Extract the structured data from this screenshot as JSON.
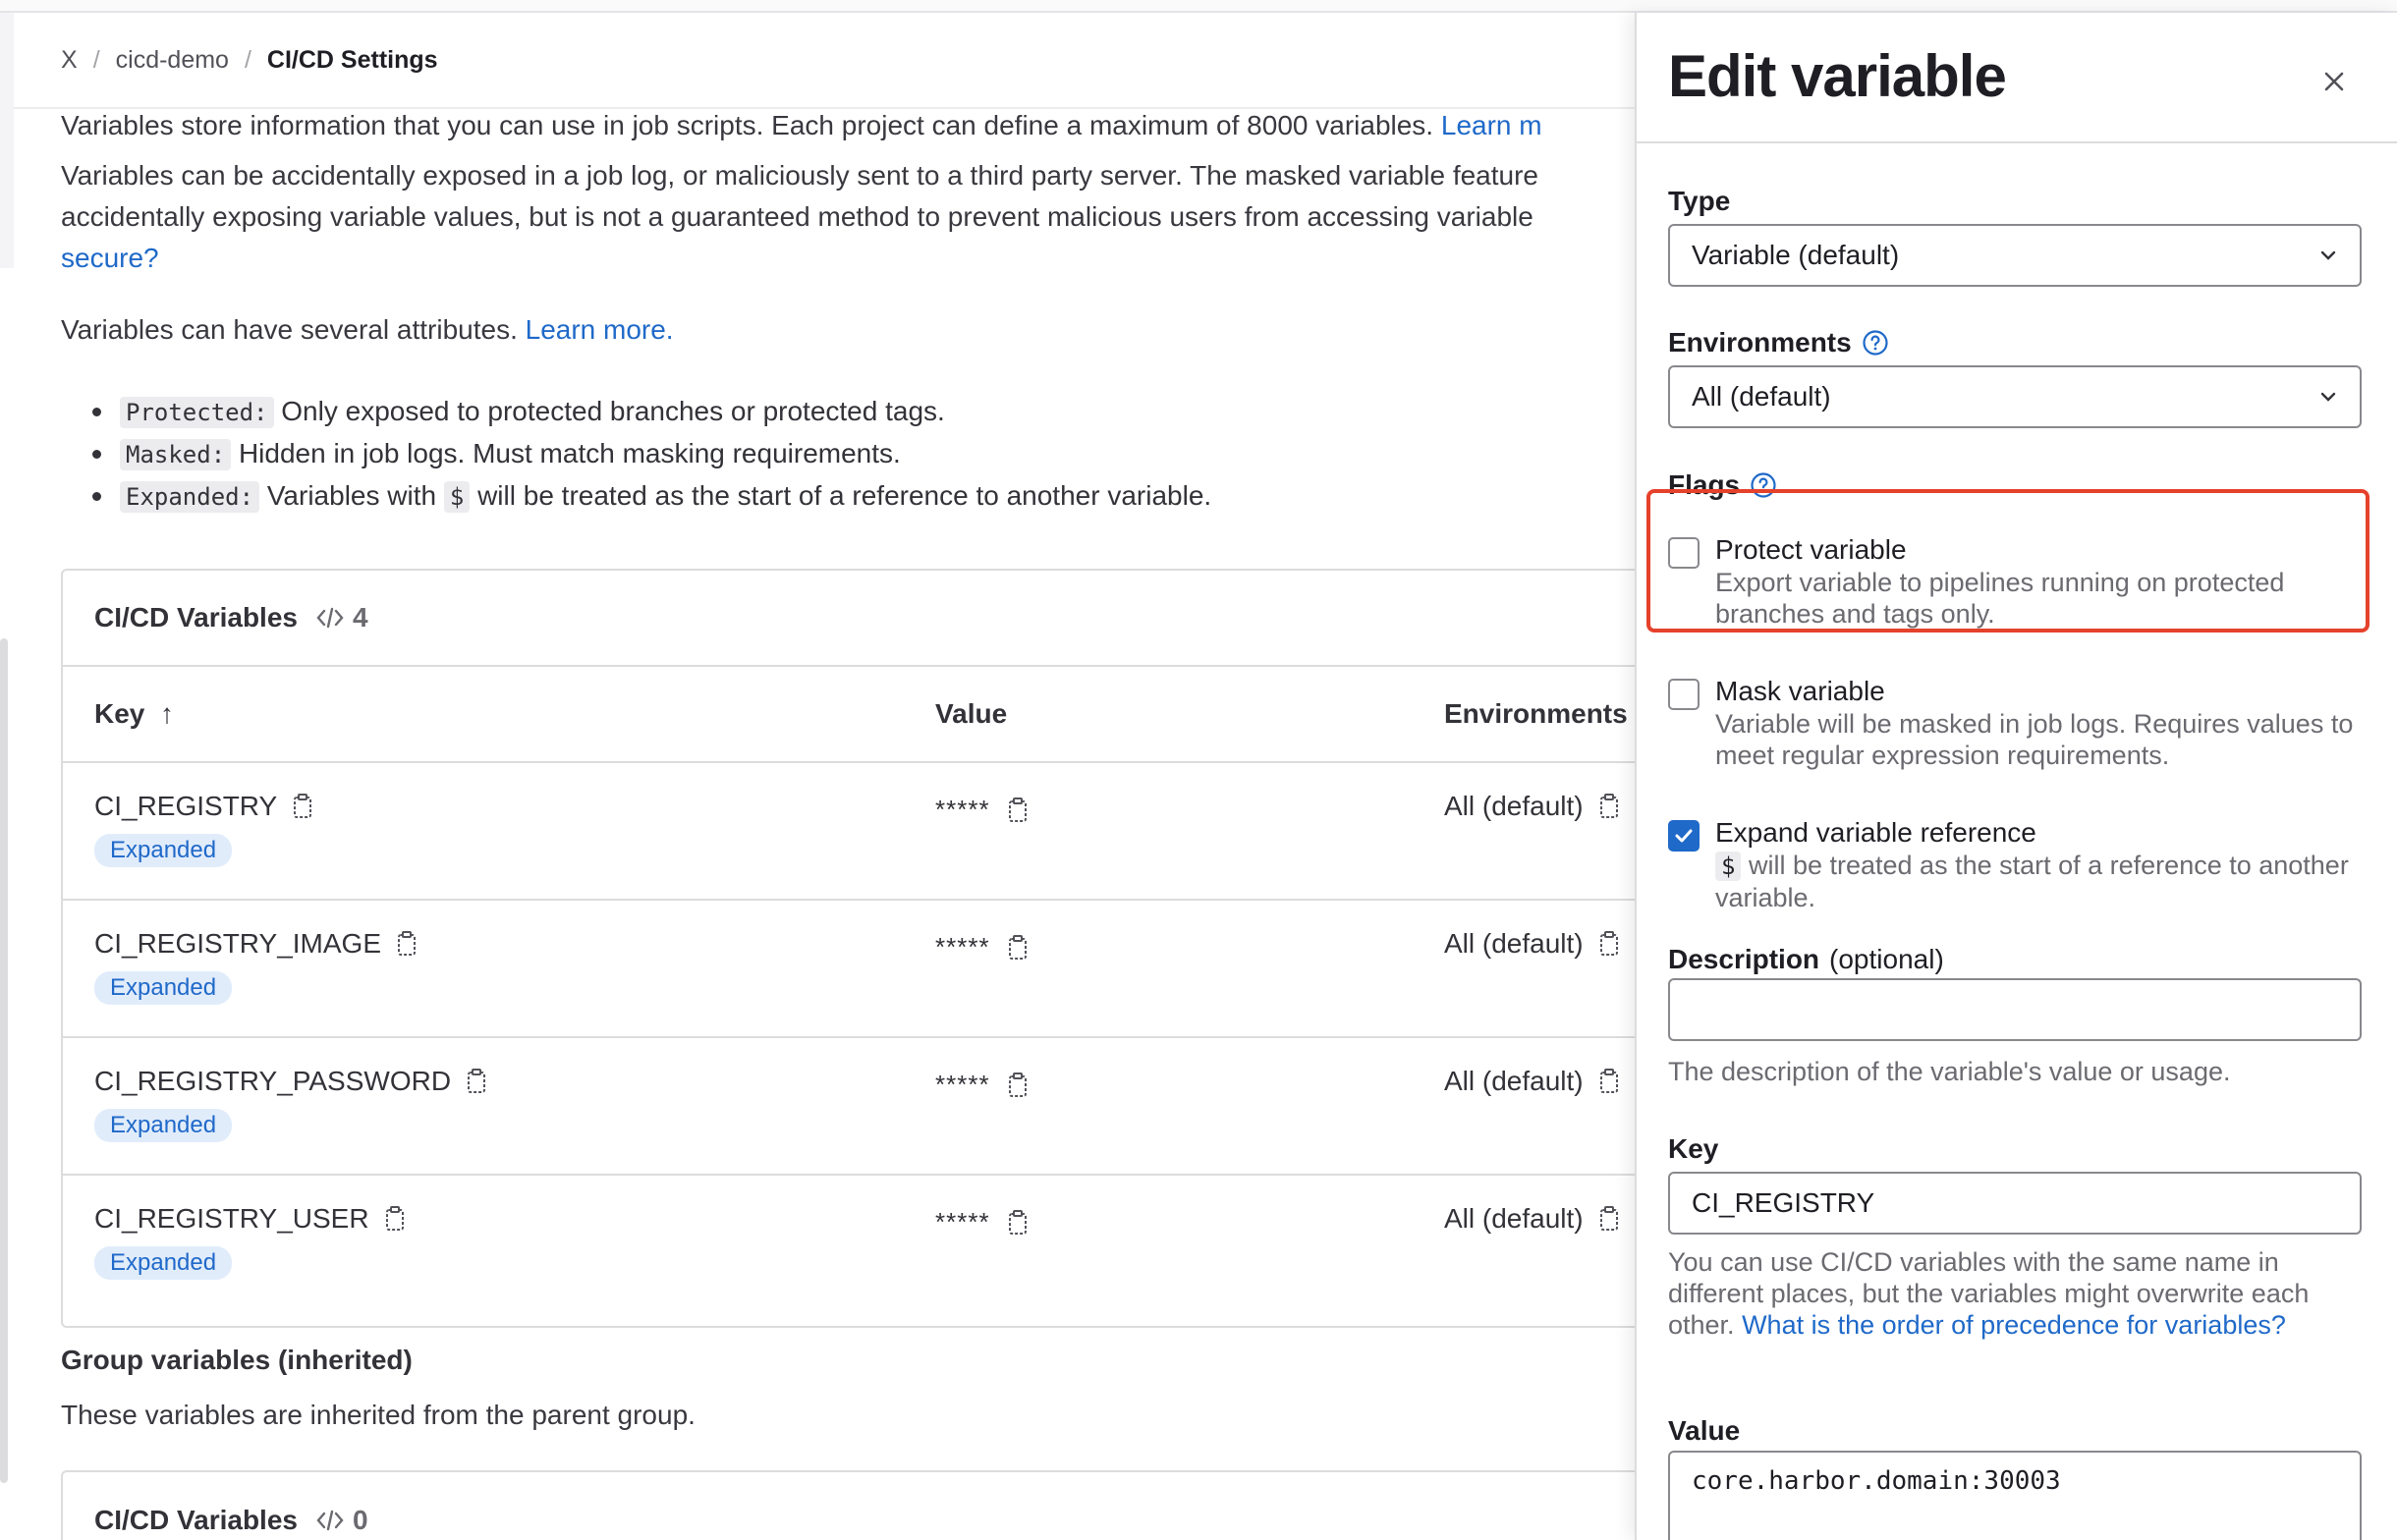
{
  "breadcrumb": {
    "root": "X",
    "project": "cicd-demo",
    "current": "CI/CD Settings"
  },
  "intro": {
    "line1": "Variables store information that you can use in job scripts. Each project can define a maximum of 8000 variables.",
    "line1_link": "Learn m",
    "para2_line1": "Variables can be accidentally exposed in a job log, or maliciously sent to a third party server. The masked variable feature",
    "para2_line2": "accidentally exposing variable values, but is not a guaranteed method to prevent malicious users from accessing variable",
    "para2_link": "secure?",
    "attrs_text": "Variables can have several attributes.",
    "attrs_link": "Learn more.",
    "attrs": [
      {
        "code": "Protected:",
        "text": "Only exposed to protected branches or protected tags."
      },
      {
        "code": "Masked:",
        "text": "Hidden in job logs. Must match masking requirements."
      },
      {
        "code": "Expanded:",
        "text_before": "Variables with",
        "inline_code": "$",
        "text_after": "will be treated as the start of a reference to another variable."
      }
    ]
  },
  "variables_card": {
    "title": "CI/CD Variables",
    "count": "4",
    "columns": {
      "key": "Key",
      "value": "Value",
      "environments": "Environments"
    },
    "sort_indicator": "↑",
    "rows": [
      {
        "key": "CI_REGISTRY",
        "badge": "Expanded",
        "value": "*****",
        "env": "All (default)"
      },
      {
        "key": "CI_REGISTRY_IMAGE",
        "badge": "Expanded",
        "value": "*****",
        "env": "All (default)"
      },
      {
        "key": "CI_REGISTRY_PASSWORD",
        "badge": "Expanded",
        "value": "*****",
        "env": "All (default)"
      },
      {
        "key": "CI_REGISTRY_USER",
        "badge": "Expanded",
        "value": "*****",
        "env": "All (default)"
      }
    ]
  },
  "group": {
    "title": "Group variables (inherited)",
    "desc": "These variables are inherited from the parent group.",
    "card_title": "CI/CD Variables",
    "card_count": "0"
  },
  "drawer": {
    "title": "Edit variable",
    "type_label": "Type",
    "type_value": "Variable (default)",
    "env_label": "Environments",
    "env_value": "All (default)",
    "flags_label": "Flags",
    "protect": {
      "label": "Protect variable",
      "help": "Export variable to pipelines running on protected branches and tags only.",
      "checked": false
    },
    "mask": {
      "label": "Mask variable",
      "help": "Variable will be masked in job logs. Requires values to meet regular expression requirements.",
      "checked": false
    },
    "expand": {
      "label": "Expand variable reference",
      "code": "$",
      "help_after": "will be treated as the start of a reference to another variable.",
      "checked": true
    },
    "desc_label": "Description",
    "desc_optional": "(optional)",
    "desc_value": "",
    "desc_hint": "The description of the variable's value or usage.",
    "key_label": "Key",
    "key_value": "CI_REGISTRY",
    "key_hint": "You can use CI/CD variables with the same name in different places, but the variables might overwrite each other.",
    "key_hint_link": "What is the order of precedence for variables?",
    "value_label": "Value",
    "value_value": "core.harbor.domain:30003"
  },
  "colors": {
    "link": "#1f69c9",
    "highlight": "#e5412b",
    "badge_bg": "#e1ecfb"
  }
}
